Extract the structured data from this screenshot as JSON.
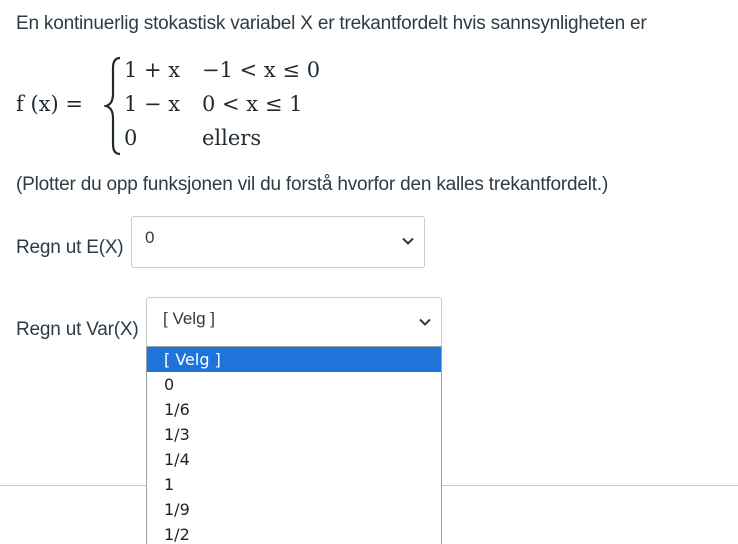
{
  "intro_text": "En kontinuerlig stokastisk variabel X er trekantfordelt hvis sannsynligheten er",
  "formula": {
    "lhs": "f (x) =",
    "cases": [
      {
        "expr": "1 + x",
        "cond": "−1 < x ≤ 0"
      },
      {
        "expr": "1 − x",
        "cond": "0 < x ≤ 1"
      },
      {
        "expr": "0",
        "cond": "ellers"
      }
    ]
  },
  "note_text": "(Plotter du opp funksjonen vil du forstå hvorfor den kalles trekantfordelt.)",
  "question_ex": {
    "label": "Regn ut E(X)",
    "selected": "0"
  },
  "question_var": {
    "label": "Regn ut Var(X)",
    "selected": "[ Velg ]",
    "options": [
      "[ Velg ]",
      "0",
      "1/6",
      "1/3",
      "1/4",
      "1",
      "1/9",
      "1/2"
    ],
    "highlighted_index": 0
  },
  "colors": {
    "text": "#2d3b45",
    "border": "#c7cdd1",
    "highlight": "#1e74d8"
  },
  "icons": {
    "dropdown_arrow": "chevron-down-icon"
  }
}
